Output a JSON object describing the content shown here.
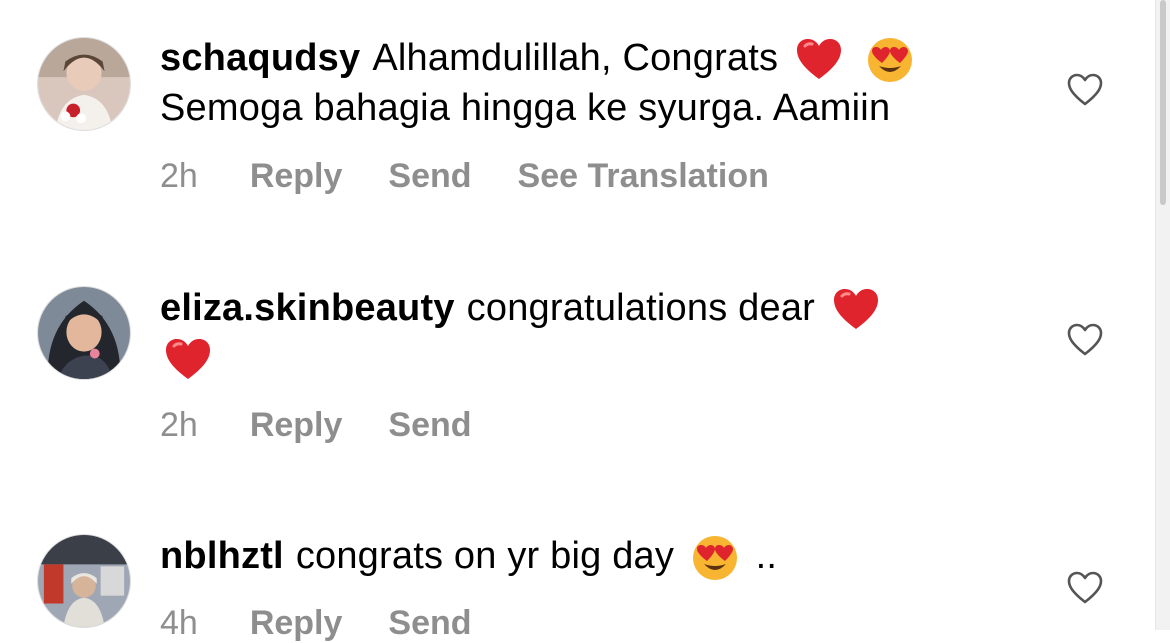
{
  "comments": [
    {
      "username": "schaqudsy",
      "text_parts": [
        "Alhamdulillah, Congrats",
        "Semoga bahagia hingga ke syurga. Aamiin"
      ],
      "emojis": [
        "red-heart-emoji",
        "heart-eyes-emoji"
      ],
      "time": "2h",
      "actions": [
        "Reply",
        "Send",
        "See Translation"
      ]
    },
    {
      "username": "eliza.skinbeauty",
      "text_parts": [
        "congratulations dear"
      ],
      "emojis": [
        "red-heart-emoji",
        "red-heart-emoji"
      ],
      "time": "2h",
      "actions": [
        "Reply",
        "Send"
      ]
    },
    {
      "username": "nblhztl",
      "text_parts": [
        "congrats on yr big day",
        ".."
      ],
      "emojis": [
        "heart-eyes-emoji"
      ],
      "time": "4h",
      "actions": [
        "Reply",
        "Send"
      ]
    }
  ],
  "icons": {
    "like": "heart-outline-icon"
  },
  "colors": {
    "meta_text": "#8e8e8e",
    "heart_red": "#e0242e",
    "emoji_yellow": "#f7b531"
  }
}
